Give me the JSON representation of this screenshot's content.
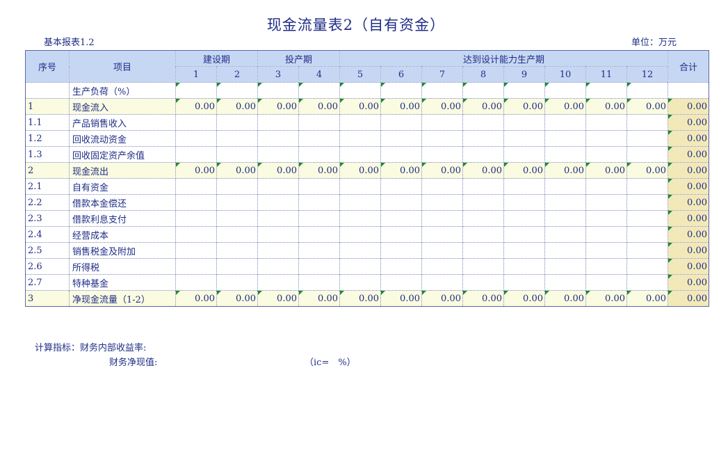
{
  "title": "现金流量表2（自有资金）",
  "sub_left": "基本报表1.2",
  "sub_right": "单位：万元",
  "headers": {
    "seq": "序号",
    "item": "项目",
    "build": "建设期",
    "invest": "投产期",
    "design": "达到设计能力生产期",
    "total": "合计",
    "years": [
      "1",
      "2",
      "3",
      "4",
      "5",
      "6",
      "7",
      "8",
      "9",
      "10",
      "11",
      "12"
    ]
  },
  "rows": [
    {
      "code": "",
      "item": "生产负荷（%）",
      "values": [
        "",
        "",
        "",
        "",
        "",
        "",
        "",
        "",
        "",
        "",
        "",
        ""
      ],
      "total": "",
      "kind": "load"
    },
    {
      "code": "1",
      "item": "现金流入",
      "values": [
        "0.00",
        "0.00",
        "0.00",
        "0.00",
        "0.00",
        "0.00",
        "0.00",
        "0.00",
        "0.00",
        "0.00",
        "0.00",
        "0.00"
      ],
      "total": "0.00",
      "kind": "sum"
    },
    {
      "code": "1.1",
      "item": "产品销售收入",
      "values": [
        "",
        "",
        "",
        "",
        "",
        "",
        "",
        "",
        "",
        "",
        "",
        ""
      ],
      "total": "0.00",
      "kind": "detail"
    },
    {
      "code": "1.2",
      "item": "回收流动资金",
      "values": [
        "",
        "",
        "",
        "",
        "",
        "",
        "",
        "",
        "",
        "",
        "",
        ""
      ],
      "total": "0.00",
      "kind": "detail"
    },
    {
      "code": "1.3",
      "item": "回收固定资产余值",
      "values": [
        "",
        "",
        "",
        "",
        "",
        "",
        "",
        "",
        "",
        "",
        "",
        ""
      ],
      "total": "0.00",
      "kind": "detail"
    },
    {
      "code": "2",
      "item": "现金流出",
      "values": [
        "0.00",
        "0.00",
        "0.00",
        "0.00",
        "0.00",
        "0.00",
        "0.00",
        "0.00",
        "0.00",
        "0.00",
        "0.00",
        "0.00"
      ],
      "total": "0.00",
      "kind": "sum"
    },
    {
      "code": "2.1",
      "item": "自有资金",
      "values": [
        "",
        "",
        "",
        "",
        "",
        "",
        "",
        "",
        "",
        "",
        "",
        ""
      ],
      "total": "0.00",
      "kind": "detail"
    },
    {
      "code": "2.2",
      "item": "借款本金偿还",
      "values": [
        "",
        "",
        "",
        "",
        "",
        "",
        "",
        "",
        "",
        "",
        "",
        ""
      ],
      "total": "0.00",
      "kind": "detail"
    },
    {
      "code": "2.3",
      "item": "借款利息支付",
      "values": [
        "",
        "",
        "",
        "",
        "",
        "",
        "",
        "",
        "",
        "",
        "",
        ""
      ],
      "total": "0.00",
      "kind": "detail"
    },
    {
      "code": "2.4",
      "item": "经营成本",
      "values": [
        "",
        "",
        "",
        "",
        "",
        "",
        "",
        "",
        "",
        "",
        "",
        ""
      ],
      "total": "0.00",
      "kind": "detail"
    },
    {
      "code": "2.5",
      "item": "销售税金及附加",
      "values": [
        "",
        "",
        "",
        "",
        "",
        "",
        "",
        "",
        "",
        "",
        "",
        ""
      ],
      "total": "0.00",
      "kind": "detail"
    },
    {
      "code": "2.6",
      "item": "所得税",
      "values": [
        "",
        "",
        "",
        "",
        "",
        "",
        "",
        "",
        "",
        "",
        "",
        ""
      ],
      "total": "0.00",
      "kind": "detail"
    },
    {
      "code": "2.7",
      "item": "特种基金",
      "values": [
        "",
        "",
        "",
        "",
        "",
        "",
        "",
        "",
        "",
        "",
        "",
        ""
      ],
      "total": "0.00",
      "kind": "detail"
    },
    {
      "code": "3",
      "item": "净现金流量（1-2）",
      "values": [
        "0.00",
        "0.00",
        "0.00",
        "0.00",
        "0.00",
        "0.00",
        "0.00",
        "0.00",
        "0.00",
        "0.00",
        "0.00",
        "0.00"
      ],
      "total": "0.00",
      "kind": "sum"
    }
  ],
  "footer": {
    "line1": "计算指标：财务内部收益率:",
    "line2": "财务净现值:",
    "line3": "（ic=　%）"
  },
  "colors": {
    "header_bg": "#c6d7f3",
    "sum_row_bg": "#fafbe0",
    "total_col_bg": "#f3e9b8",
    "corner_mark": "#1d8a2e",
    "text": "#1f2d86"
  }
}
